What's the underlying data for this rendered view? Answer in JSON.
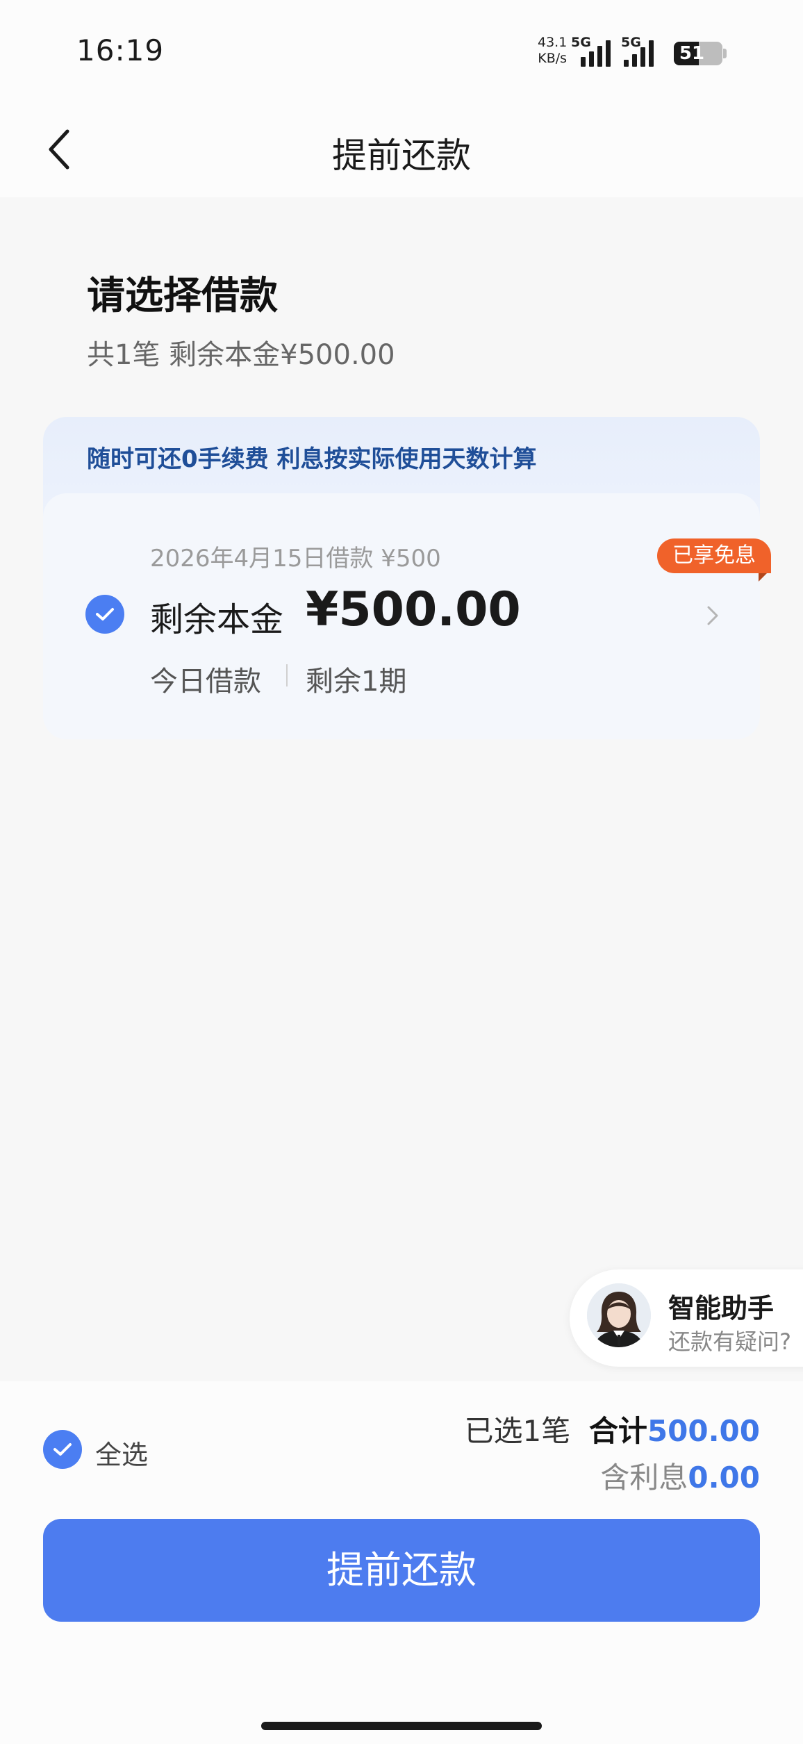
{
  "status_bar": {
    "time": "16:19",
    "net_speed_value": "43.1",
    "net_speed_unit": "KB/s",
    "sim1_label": "5G",
    "sim2_label": "5G",
    "battery": "51",
    "battery_level": 0.51
  },
  "nav": {
    "title": "提前还款",
    "back_icon": "chevron-left-icon"
  },
  "header": {
    "title": "请选择借款",
    "summary": "共1笔 剩余本金¥500.00"
  },
  "card": {
    "banner": "随时可还0手续费 利息按实际使用天数计算",
    "badge": "已享免息",
    "loan_date": "2026年4月15日借款 ¥500",
    "principal_label": "剩余本金",
    "principal_amount": "¥500.00",
    "tag_today": "今日借款",
    "tag_periods": "剩余1期",
    "selected": true
  },
  "assistant": {
    "title": "智能助手",
    "subtitle": "还款有疑问?"
  },
  "footer": {
    "select_all_label": "全选",
    "selected_count_text": "已选1笔",
    "total_label": "合计",
    "total_value": "500.00",
    "interest_label": "含利息",
    "interest_value": "0.00",
    "button_label": "提前还款"
  },
  "colors": {
    "accent": "#4d7cef",
    "badge": "#f0622a",
    "banner_text": "#1f4e98"
  }
}
